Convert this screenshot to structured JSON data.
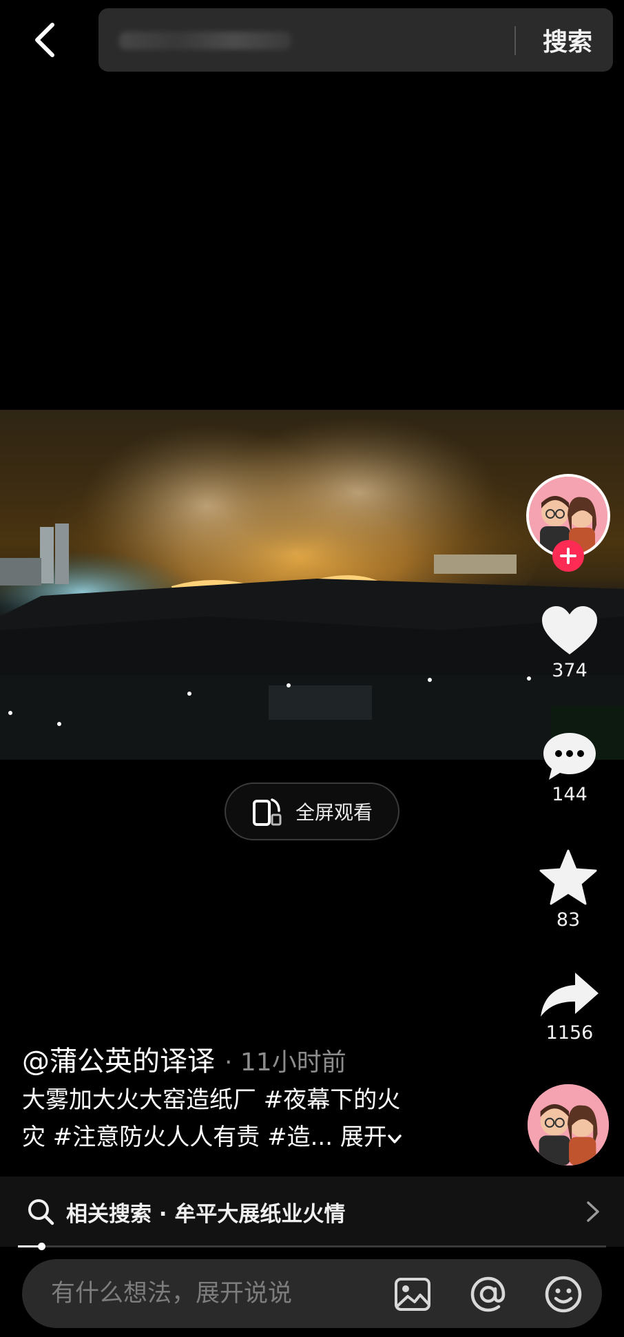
{
  "header": {
    "back_icon": "chevron-left-icon",
    "search_submit_label": "搜索"
  },
  "video": {
    "fullscreen_label": "全屏观看",
    "fullscreen_icon": "rotate-phone-icon"
  },
  "rail": {
    "follow_icon": "plus-icon",
    "like": {
      "icon": "heart-icon",
      "count": "374"
    },
    "comment": {
      "icon": "comment-bubble-icon",
      "count": "144"
    },
    "favorite": {
      "icon": "star-icon",
      "count": "83"
    },
    "share": {
      "icon": "share-arrow-icon",
      "count": "1156"
    }
  },
  "caption": {
    "author": "@蒲公英的译译",
    "time": "· 11小时前",
    "text_line1": "大雾加大火大窑造纸厂 #夜幕下的火",
    "text_line2": "灾 #注意防火人人有责 #造...",
    "expand_label": "展开"
  },
  "related": {
    "icon": "search-icon",
    "text": "相关搜索 · 牟平大展纸业火情",
    "arrow_icon": "chevron-right-icon"
  },
  "playback": {
    "progress": 0.04
  },
  "comment_bar": {
    "placeholder": "有什么想法，展开说说",
    "icons": [
      "image-icon",
      "at-icon",
      "emoji-icon"
    ]
  },
  "colors": {
    "accent": "#fe2c55",
    "background": "#000000",
    "bar": "#2a2a2a"
  }
}
